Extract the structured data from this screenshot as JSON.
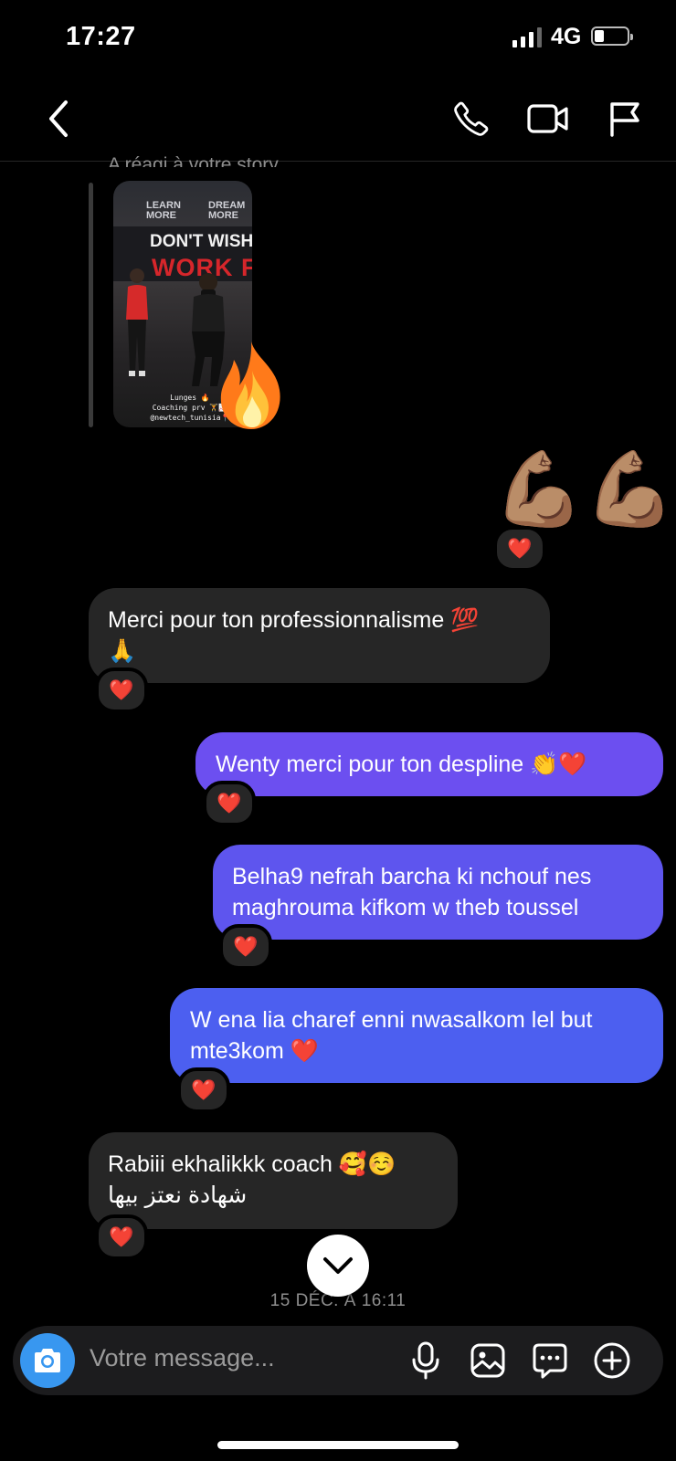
{
  "status_bar": {
    "time": "17:27",
    "network": "4G"
  },
  "header": {
    "back_icon": "chevron-left-icon",
    "call_icon": "phone-icon",
    "video_icon": "video-camera-icon",
    "report_icon": "flag-icon"
  },
  "story_reply": {
    "label": "A réagi à votre story",
    "image": {
      "text_learn": "LEARN\nMORE",
      "text_dream": "DREAM\nMORE",
      "text_line1": "DON'T WISH I",
      "text_line2": "WORK FO",
      "caption": "Lunges 🔥\nCoaching prv 🏋📈\n@newtech_tunisia📍"
    },
    "sticker": "🔥"
  },
  "messages": [
    {
      "direction": "outgoing",
      "text": "💪🏽💪🏽",
      "reaction": "❤️"
    },
    {
      "direction": "incoming",
      "text": "Merci pour ton professionnalisme 💯\n🙏",
      "reaction": "❤️"
    },
    {
      "direction": "outgoing",
      "text": "Wenty merci pour ton despline 👏❤️",
      "reaction": "❤️"
    },
    {
      "direction": "outgoing",
      "text": "Belha9 nefrah barcha ki nchouf nes\nmaghrouma kifkom w theb toussel",
      "reaction": "❤️"
    },
    {
      "direction": "outgoing",
      "text": "W ena lia charef enni nwasalkom lel but\nmte3kom ❤️",
      "reaction": "❤️"
    },
    {
      "direction": "incoming",
      "text": "Rabiii ekhalikkk coach 🥰☺️",
      "text_rtl": "شهادة نعتز بيها",
      "reaction": "❤️"
    }
  ],
  "timestamp": "15 DÉC. À 16:11",
  "composer": {
    "placeholder": "Votre message...",
    "icons": [
      "camera-icon",
      "microphone-icon",
      "gallery-icon",
      "sticker-chat-icon",
      "plus-circle-icon"
    ]
  },
  "colors": {
    "background": "#000000",
    "incoming_bubble": "#262626",
    "outgoing_top": "#6c4ff0",
    "outgoing_mid": "#5e55ee",
    "outgoing_bottom": "#4c5ff0",
    "camera_button": "#3897f0"
  }
}
